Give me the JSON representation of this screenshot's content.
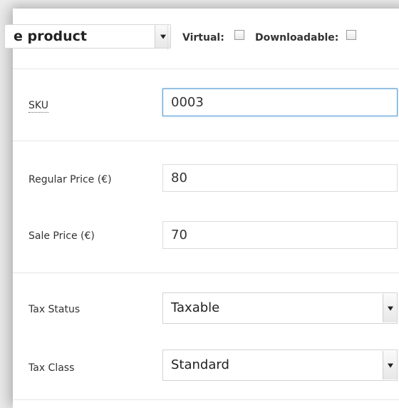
{
  "header": {
    "product_type_selected": "e product",
    "virtual_label": "Virtual:",
    "downloadable_label": "Downloadable:"
  },
  "fields": {
    "sku": {
      "label": "SKU",
      "value": "0003"
    },
    "regular_price": {
      "label": "Regular Price (€)",
      "value": "80"
    },
    "sale_price": {
      "label": "Sale Price (€)",
      "value": "70"
    },
    "tax_status": {
      "label": "Tax Status",
      "value": "Taxable"
    },
    "tax_class": {
      "label": "Tax Class",
      "value": "Standard"
    }
  },
  "icons": {
    "select_arrow": "caret-down-icon",
    "checkbox": "checkbox-icon"
  },
  "colors": {
    "focus_border": "#5b9dd9",
    "divider": "#e5e5e5",
    "text": "#333333"
  }
}
